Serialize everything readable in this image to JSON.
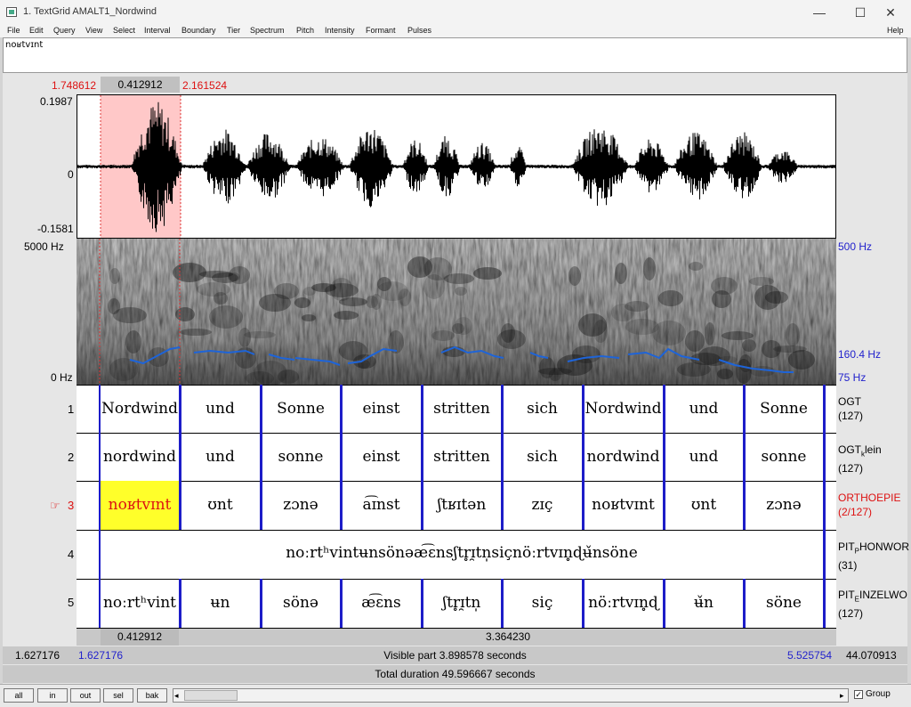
{
  "window": {
    "title": "1. TextGrid AMALT1_Nordwind",
    "minimize": "—",
    "maximize": "☐",
    "close": "✕"
  },
  "menu": [
    "File",
    "Edit",
    "Query",
    "View",
    "Select",
    "Interval",
    "Boundary",
    "Tier",
    "Spectrum",
    "Pitch",
    "Intensity",
    "Formant",
    "Pulses"
  ],
  "help": "Help",
  "text_value": "noʁtvɪnt",
  "selection": {
    "start": "1.748612",
    "duration": "0.412912",
    "end": "2.161524"
  },
  "waveform": {
    "max": "0.1987",
    "zero": "0",
    "min": "-0.1581"
  },
  "spectrogram": {
    "top": "5000 Hz",
    "bottom": "0 Hz",
    "pitch_top": "500 Hz",
    "pitch_cursor": "160.4 Hz",
    "pitch_bottom": "75 Hz"
  },
  "tiers": [
    {
      "num": "1",
      "name": "OGT",
      "count": "(127)",
      "active": false,
      "cells": [
        "Nordwind",
        "und",
        "Sonne",
        "einst",
        "stritten",
        "sich",
        "Nordwind",
        "und",
        "Sonne"
      ]
    },
    {
      "num": "2",
      "name_main": "OGT",
      "name_sub": "k",
      "name_rest": "lein",
      "count": "(127)",
      "active": false,
      "cells": [
        "nordwind",
        "und",
        "sonne",
        "einst",
        "stritten",
        "sich",
        "nordwind",
        "und",
        "sonne"
      ]
    },
    {
      "num": "3",
      "name": "ORTHOEPIE",
      "count": "(2/127)",
      "active": true,
      "cells": [
        "noʁtvɪnt",
        "ʊnt",
        "zɔnə",
        "a͡ɪnst",
        "ʃtʁɪtən",
        "zɪç",
        "noʁtvɪnt",
        "ʊnt",
        "zɔnə"
      ]
    },
    {
      "num": "4",
      "name_main": "PIT",
      "name_sub": "P",
      "name_rest": "HONWOR",
      "count": "(31)",
      "active": false,
      "cell": "noːrtʰvintʉnsönəæ͡ɛnsʃtr̥ɪ̯tn̩siçnöːrtvɪn̥ɖʉ̌nsöne"
    },
    {
      "num": "5",
      "name_main": "PIT",
      "name_sub": "E",
      "name_rest": "INZELWO",
      "count": "(127)",
      "active": false,
      "cells": [
        "noːrtʰvint",
        "ʉn",
        "sönə",
        "æ͡ɛns",
        "ʃtr̥ɪ̯tn̩",
        "siç",
        "nöːrtvɪn̥ɖ",
        "ʉ̌n",
        "söne"
      ]
    }
  ],
  "bottom": {
    "seg_sel": "0.412912",
    "seg_rest": "3.364230",
    "left_total": "1.627176",
    "visible_start": "1.627176",
    "visible": "Visible part 3.898578 seconds",
    "visible_end": "5.525754",
    "right_total": "44.070913",
    "total": "Total duration 49.596667 seconds"
  },
  "buttons": [
    "all",
    "in",
    "out",
    "sel",
    "bak"
  ],
  "group_label": "Group",
  "pointer_glyph": "☞"
}
